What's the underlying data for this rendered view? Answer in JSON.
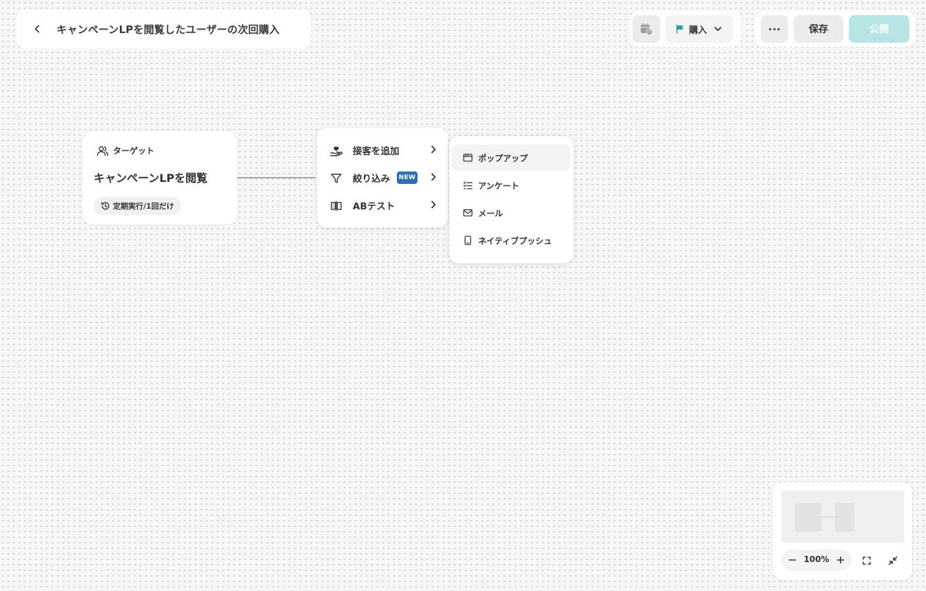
{
  "header": {
    "title": "キャンペーンLPを閲覧したユーザーの次回購入",
    "goal_label": "購入",
    "more_label": "···",
    "save_label": "保存",
    "publish_label": "公開"
  },
  "target_node": {
    "header_label": "ターゲット",
    "name": "キャンペーンLPを閲覧",
    "schedule_label": "定期実行/1回だけ"
  },
  "action_menu": {
    "items": [
      {
        "label": "接客を追加",
        "icon": "hand-heart-icon"
      },
      {
        "label": "絞り込み",
        "icon": "filter-icon",
        "badge": "NEW"
      },
      {
        "label": "ABテスト",
        "icon": "ab-test-icon"
      }
    ]
  },
  "sub_menu": {
    "items": [
      {
        "label": "ポップアップ",
        "icon": "popup-window-icon"
      },
      {
        "label": "アンケート",
        "icon": "checklist-icon"
      },
      {
        "label": "メール",
        "icon": "mail-icon"
      },
      {
        "label": "ネイティブプッシュ",
        "icon": "mobile-icon"
      }
    ]
  },
  "minimap": {
    "zoom_level": "100%"
  },
  "colors": {
    "accent": "#2a9d9f",
    "publish_disabled": "#b9e4e6",
    "new_badge": "#2f6db0"
  }
}
